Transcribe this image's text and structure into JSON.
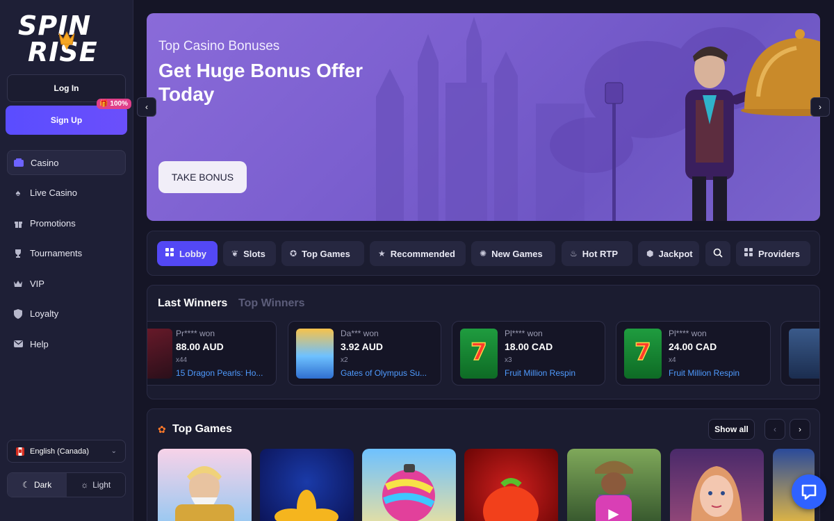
{
  "brand": {
    "line1": "SPIN",
    "line2": "RISE"
  },
  "auth": {
    "login_label": "Log In",
    "signup_label": "Sign Up",
    "signup_badge": "100%"
  },
  "sidebar": {
    "items": [
      {
        "label": "Casino",
        "icon": "casino-icon",
        "active": true
      },
      {
        "label": "Live Casino",
        "icon": "live-casino-icon"
      },
      {
        "label": "Promotions",
        "icon": "gift-icon"
      },
      {
        "label": "Tournaments",
        "icon": "trophy-icon"
      },
      {
        "label": "VIP",
        "icon": "crown-icon"
      },
      {
        "label": "Loyalty",
        "icon": "shield-icon"
      },
      {
        "label": "Help",
        "icon": "mail-icon"
      }
    ],
    "language": "English (Canada)",
    "theme": {
      "dark_label": "Dark",
      "light_label": "Light",
      "selected": "Dark"
    }
  },
  "hero": {
    "subtitle": "Top Casino Bonuses",
    "title": "Get Huge Bonus Offer Today",
    "cta": "TAKE BONUS"
  },
  "tabs": [
    {
      "label": "Lobby",
      "icon": "grid-icon",
      "active": true
    },
    {
      "label": "Slots",
      "icon": "cherry-icon"
    },
    {
      "label": "Top Games",
      "icon": "medal-icon"
    },
    {
      "label": "Recommended",
      "icon": "star-icon"
    },
    {
      "label": "New Games",
      "icon": "new-icon"
    },
    {
      "label": "Hot RTP",
      "icon": "flame-icon"
    },
    {
      "label": "Jackpot",
      "icon": "jackpot-icon"
    },
    {
      "label": "Providers",
      "icon": "grid-icon"
    }
  ],
  "winners": {
    "tab_last": "Last Winners",
    "tab_top": "Top Winners",
    "cards": [
      {
        "name": "Pr**** won",
        "amount": "88.00 AUD",
        "mult": "x44",
        "game": "15 Dragon Pearls: Ho..."
      },
      {
        "name": "Da*** won",
        "amount": "3.92 AUD",
        "mult": "x2",
        "game": "Gates of Olympus Su..."
      },
      {
        "name": "Pl**** won",
        "amount": "18.00 CAD",
        "mult": "x3",
        "game": "Fruit Million Respin"
      },
      {
        "name": "Pl**** won",
        "amount": "24.00 CAD",
        "mult": "x4",
        "game": "Fruit Million Respin"
      }
    ]
  },
  "top_games": {
    "title": "Top Games",
    "show_all": "Show all"
  },
  "colors": {
    "accent": "#5348f5",
    "background": "#151526",
    "panel": "#1b1c30",
    "link": "#4f9bff"
  }
}
